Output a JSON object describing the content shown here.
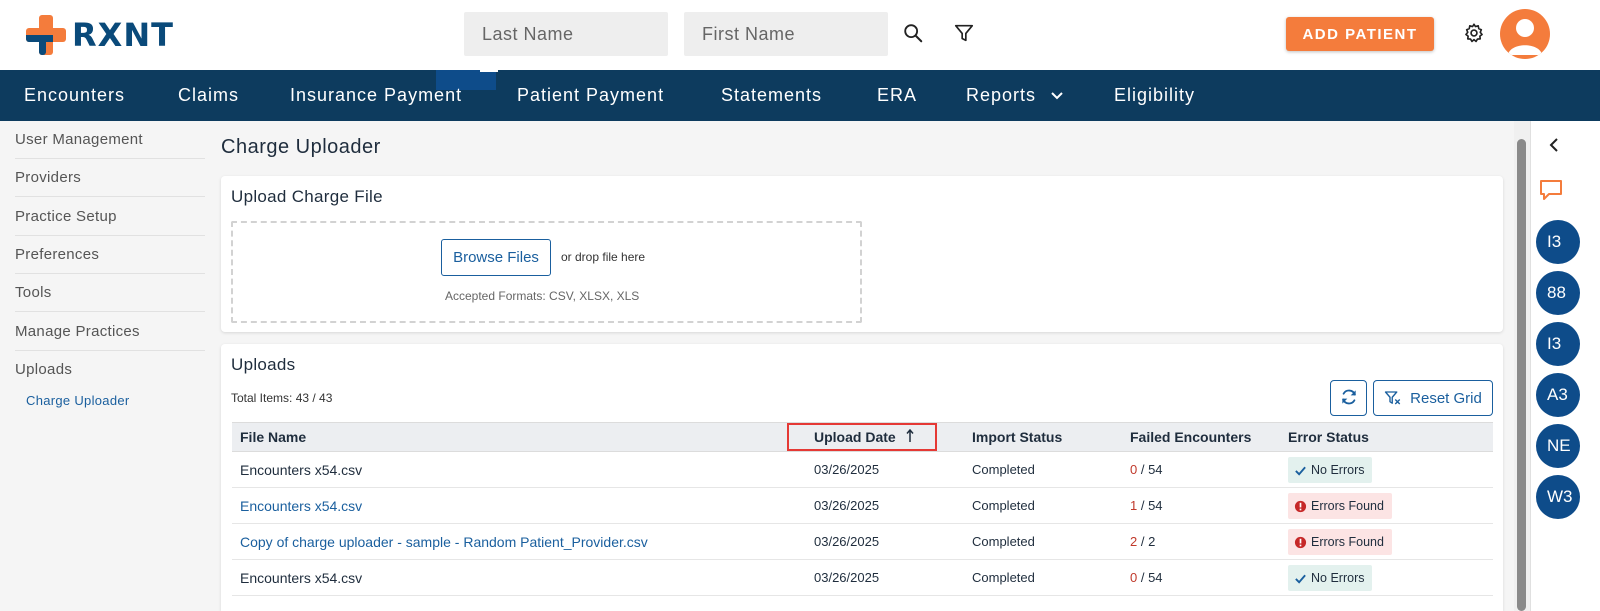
{
  "logo": {
    "text": "RXNT"
  },
  "search": {
    "last_name_placeholder": "Last Name",
    "first_name_placeholder": "First Name"
  },
  "header": {
    "add_patient_label": "ADD PATIENT"
  },
  "nav": {
    "items": [
      "Encounters",
      "Claims",
      "Insurance Payment",
      "Patient Payment",
      "Statements",
      "ERA",
      "Reports",
      "Eligibility"
    ]
  },
  "sidebar": {
    "items": [
      "User Management",
      "Providers",
      "Practice Setup",
      "Preferences",
      "Tools",
      "Manage Practices",
      "Uploads"
    ],
    "sub_item": "Charge Uploader"
  },
  "page": {
    "title": "Charge Uploader"
  },
  "upload_card": {
    "title": "Upload Charge File",
    "browse_label": "Browse Files",
    "drop_text": "or drop file here",
    "formats_text": "Accepted Formats: CSV, XLSX, XLS"
  },
  "uploads_card": {
    "title": "Uploads",
    "total_items": "Total Items: 43 / 43",
    "reset_label": "Reset Grid",
    "columns": {
      "file_name": "File Name",
      "upload_date": "Upload Date",
      "import_status": "Import Status",
      "failed_encounters": "Failed Encounters",
      "error_status": "Error Status"
    },
    "rows": [
      {
        "file": "Encounters x54.csv",
        "date": "03/26/2025",
        "status": "Completed",
        "failed": "0",
        "total": " / 54",
        "error": "No Errors"
      },
      {
        "file": "Encounters x54.csv",
        "date": "03/26/2025",
        "status": "Completed",
        "failed": "1",
        "total": " / 54",
        "error": "Errors Found"
      },
      {
        "file": "Copy of charge uploader - sample - Random Patient_Provider.csv",
        "date": "03/26/2025",
        "status": "Completed",
        "failed": "2",
        "total": " / 2",
        "error": "Errors Found"
      },
      {
        "file": "Encounters x54.csv",
        "date": "03/26/2025",
        "status": "Completed",
        "failed": "0",
        "total": " / 54",
        "error": "No Errors"
      }
    ]
  },
  "right_rail": {
    "circles": [
      "I3",
      "88",
      "I3",
      "A3",
      "NE",
      "W3"
    ]
  },
  "colors": {
    "brand_orange": "#f47c3c",
    "brand_navy": "#0d3b5e",
    "link_blue": "#1a5f9e",
    "highlight_red": "#e53935"
  }
}
